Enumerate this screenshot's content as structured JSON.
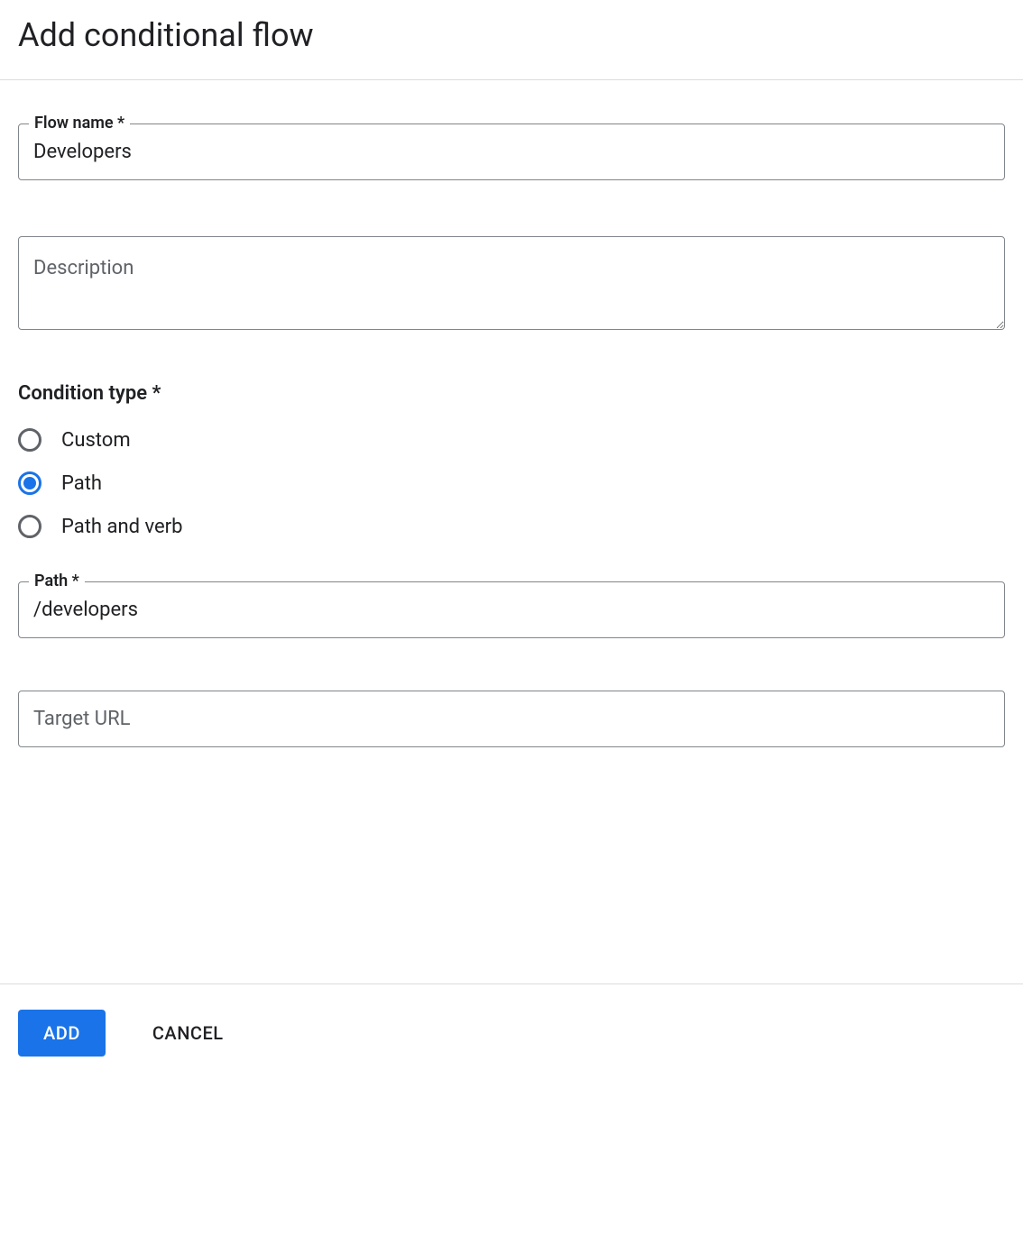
{
  "header": {
    "title": "Add conditional flow"
  },
  "form": {
    "flow_name": {
      "label": "Flow name *",
      "value": "Developers"
    },
    "description": {
      "placeholder": "Description",
      "value": ""
    },
    "condition_type": {
      "label": "Condition type *",
      "options": [
        {
          "label": "Custom",
          "value": "custom",
          "selected": false
        },
        {
          "label": "Path",
          "value": "path",
          "selected": true
        },
        {
          "label": "Path and verb",
          "value": "path_and_verb",
          "selected": false
        }
      ]
    },
    "path": {
      "label": "Path *",
      "value": "/developers"
    },
    "target_url": {
      "placeholder": "Target URL",
      "value": ""
    }
  },
  "footer": {
    "add_label": "ADD",
    "cancel_label": "CANCEL"
  }
}
